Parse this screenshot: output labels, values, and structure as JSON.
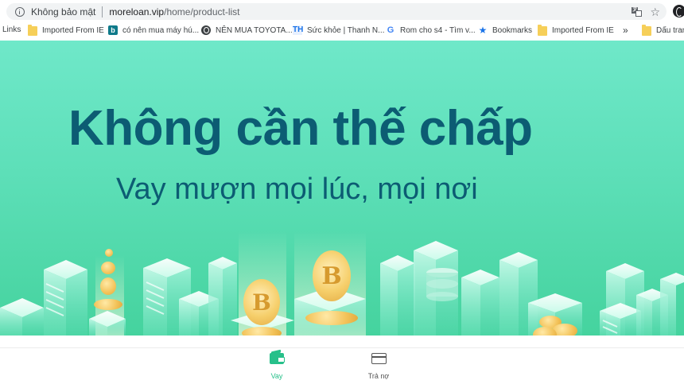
{
  "browser": {
    "security_label": "Không bảo mật",
    "url_host": "moreloan.vip",
    "url_path": "/home/product-list"
  },
  "bookmarks": [
    {
      "label": "Links",
      "icon": "none"
    },
    {
      "label": "Imported From IE",
      "icon": "folder-icon"
    },
    {
      "label": "có nên mua máy hú...",
      "icon": "bing-icon"
    },
    {
      "label": "NÊN MUA TOYOTA...",
      "icon": "globe-icon"
    },
    {
      "label": "Sức khỏe | Thanh N...",
      "icon": "th-icon"
    },
    {
      "label": "Rom cho s4 - Tìm v...",
      "icon": "google-icon"
    },
    {
      "label": "Bookmarks",
      "icon": "star-icon"
    },
    {
      "label": "Imported From IE",
      "icon": "folder-icon"
    },
    {
      "label": "Dấu trang",
      "icon": "folder-icon"
    }
  ],
  "bookmarks_overflow": "»",
  "banner": {
    "headline": "Không cần thế chấp",
    "subline": "Vay mượn mọi lúc, mọi nơi"
  },
  "bottom_nav": {
    "items": [
      {
        "label": "Vay",
        "icon": "wallet-icon",
        "active": true,
        "color": "#27c08a"
      },
      {
        "label": "Trả nợ",
        "icon": "credit-card-icon",
        "active": false,
        "color": "#555555"
      }
    ]
  }
}
